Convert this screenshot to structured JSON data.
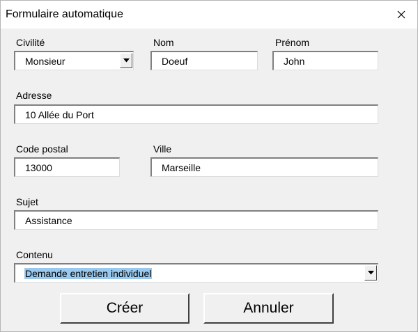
{
  "window": {
    "title": "Formulaire automatique"
  },
  "form": {
    "civilite": {
      "label": "Civilité",
      "value": "Monsieur"
    },
    "nom": {
      "label": "Nom",
      "value": "Doeuf"
    },
    "prenom": {
      "label": "Prénom",
      "value": "John"
    },
    "adresse": {
      "label": "Adresse",
      "value": "10 Allée du Port"
    },
    "code_postal": {
      "label": "Code postal",
      "value": "13000"
    },
    "ville": {
      "label": "Ville",
      "value": "Marseille"
    },
    "sujet": {
      "label": "Sujet",
      "value": "Assistance"
    },
    "contenu": {
      "label": "Contenu",
      "value": "Demande entretien individuel"
    }
  },
  "buttons": {
    "create": "Créer",
    "cancel": "Annuler"
  },
  "icons": {
    "close": "close-icon",
    "dropdown": "chevron-down-icon"
  },
  "colors": {
    "selection": "#99c9ef",
    "window_bg": "#f0f0f0"
  }
}
